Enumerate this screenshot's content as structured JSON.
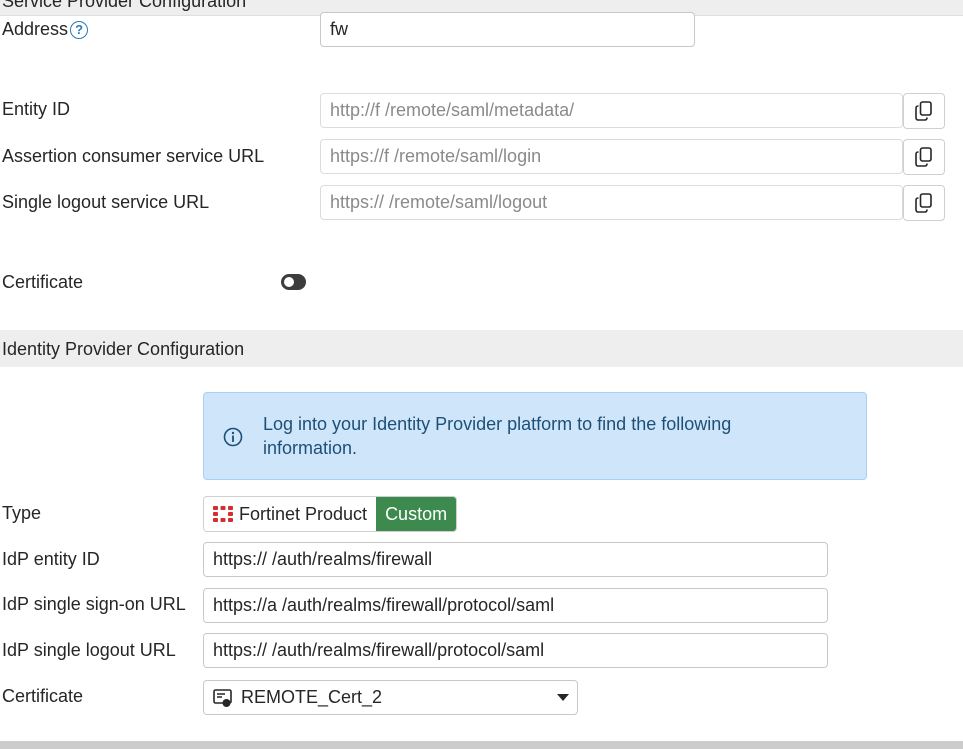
{
  "service_provider": {
    "section_title": "Service Provider Configuration",
    "address_label": "Address",
    "address_value": "fw",
    "entity_id_label": "Entity ID",
    "entity_id_value": "http://f                /remote/saml/metadata/",
    "acs_url_label": "Assertion consumer service URL",
    "acs_url_value": "https://f                /remote/saml/login",
    "slo_url_label": "Single logout service URL",
    "slo_url_value": "https://                 /remote/saml/logout",
    "certificate_label": "Certificate",
    "certificate_enabled": false
  },
  "identity_provider": {
    "section_title": "Identity Provider Configuration",
    "info_text": "Log into your Identity Provider platform to find the following information.",
    "type_label": "Type",
    "type_options": [
      "Fortinet Product",
      "Custom"
    ],
    "type_selected": "Custom",
    "idp_entity_id_label": "IdP entity ID",
    "idp_entity_id_value": "https://               /auth/realms/firewall",
    "idp_sso_url_label": "IdP single sign-on URL",
    "idp_sso_url_value": "https://a              /auth/realms/firewall/protocol/saml",
    "idp_slo_url_label": "IdP single logout URL",
    "idp_slo_url_value": "https://               /auth/realms/firewall/protocol/saml",
    "certificate_label": "Certificate",
    "certificate_value": "REMOTE_Cert_2"
  },
  "icons": {
    "help": "help-icon",
    "copy": "copy-icon",
    "info": "info-icon",
    "fortinet": "fortinet-logo-icon",
    "certificate": "certificate-icon",
    "dropdown": "chevron-down-icon"
  },
  "colors": {
    "custom_active": "#3d8a4e",
    "info_bg": "#cfe6fa",
    "info_text": "#1d4f78",
    "fortinet_red": "#d32f2f",
    "section_bg": "#eeeeee"
  }
}
